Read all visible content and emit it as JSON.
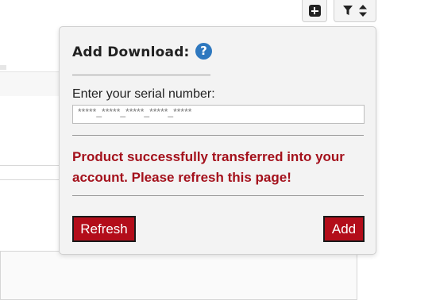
{
  "toolbar": {
    "add_icon": "plus-square-icon",
    "filter_icon": "filter-icon",
    "sort_icon": "sort-icon"
  },
  "popover": {
    "title": "Add Download:",
    "help_icon": "?",
    "serial_label": "Enter your serial number:",
    "serial_placeholder": "*****_*****_*****_*****_*****",
    "serial_value": "",
    "success_message": "Product successfully transferred into your account. Please refresh this page!",
    "refresh_label": "Refresh",
    "add_label": "Add"
  },
  "colors": {
    "accent_red": "#b30d1a",
    "message_red": "#a4111c",
    "help_blue": "#2e78bf"
  }
}
